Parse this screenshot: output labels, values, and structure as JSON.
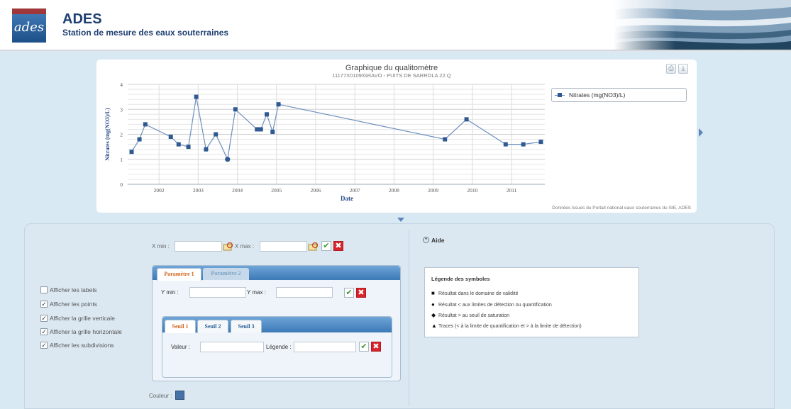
{
  "header": {
    "logo_text": "ades",
    "title": "ADES",
    "subtitle": "Station de mesure des eaux souterraines"
  },
  "chart": {
    "tools": {
      "print": "print-icon",
      "download": "download-icon"
    },
    "credit": "Données issues du Portail national eaux souterraines du SIE, ADES",
    "colors": {
      "series": "#6e8fbe",
      "marker": "#2e5a91",
      "axis_title": "#2a4d8a"
    }
  },
  "chart_data": {
    "type": "line",
    "title": "Graphique du qualitomètre",
    "subtitle": "11177X0109/GRAVO - PUITS DE SARROLA 22.Q",
    "xlabel": "Date",
    "ylabel": "Nitrates (mg(NO3)/L)",
    "xlim": [
      2001.2,
      2011.85
    ],
    "ylim": [
      0,
      4
    ],
    "x_ticks": [
      "2002",
      "2003",
      "2004",
      "2005",
      "2006",
      "2007",
      "2008",
      "2009",
      "2010",
      "2011"
    ],
    "y_ticks": [
      "0",
      "1",
      "2",
      "3",
      "4"
    ],
    "grid": {
      "vertical": true,
      "horizontal": true,
      "subdivisions": true
    },
    "legend_position": "top-right",
    "series": [
      {
        "name": "Nitrates (mg(NO3)/L)",
        "x": [
          2001.3,
          2001.5,
          2001.65,
          2002.3,
          2002.5,
          2002.75,
          2002.95,
          2003.2,
          2003.45,
          2003.75,
          2003.95,
          2004.5,
          2004.6,
          2004.75,
          2004.9,
          2005.05,
          2009.3,
          2009.85,
          2010.85,
          2011.3,
          2011.75
        ],
        "y": [
          1.3,
          1.8,
          2.4,
          1.9,
          1.6,
          1.5,
          3.5,
          1.4,
          2.0,
          1.0,
          3.0,
          2.2,
          2.2,
          2.8,
          2.1,
          3.2,
          1.8,
          2.6,
          1.6,
          1.6,
          1.7
        ],
        "markers": [
          "square",
          "square",
          "square",
          "square",
          "square",
          "square",
          "square",
          "square",
          "square",
          "circle",
          "square",
          "square",
          "square",
          "square",
          "square",
          "square",
          "square",
          "square",
          "square",
          "square",
          "square"
        ]
      }
    ]
  },
  "settings": {
    "x_range": {
      "xmin_label": "X min :",
      "xmax_label": "X max :",
      "xmin_value": "",
      "xmax_value": ""
    },
    "display_options": [
      {
        "label": "Afficher les labels",
        "checked": false
      },
      {
        "label": "Afficher les points",
        "checked": true
      },
      {
        "label": "Afficher la grille verticale",
        "checked": true
      },
      {
        "label": "Afficher la grille horizontale",
        "checked": true
      },
      {
        "label": "Afficher les subdivisions",
        "checked": true
      }
    ],
    "param_tabs": [
      "Paramètre 1",
      "Paramètre 2"
    ],
    "ymin_label": "Y min :",
    "ymax_label": "Y max :",
    "ymin_value": "",
    "ymax_value": "",
    "seuil_tabs": [
      "Seuil 1",
      "Seuil 2",
      "Seuil 3"
    ],
    "valeur_label": "Valeur :",
    "legende_label": "Légende :",
    "couleur_label": "Couleur :",
    "couleur_value": "#4472a6"
  },
  "help": {
    "label": "Aide",
    "icon": "plus-circle-icon"
  },
  "symbol_legend": {
    "title": "Légende des symboles",
    "items": [
      {
        "icon": "square-icon",
        "glyph": "■",
        "text": "Résultat dans le domaine de validité"
      },
      {
        "icon": "circle-icon",
        "glyph": "●",
        "text": "Résultat < aux limites de détection ou quantification"
      },
      {
        "icon": "diamond-icon",
        "glyph": "◆",
        "text": "Résultat > au seuil de saturation"
      },
      {
        "icon": "triangle-icon",
        "glyph": "▲",
        "text": "Traces (< à la limite de quantification et > à la limite de détection)"
      }
    ]
  }
}
